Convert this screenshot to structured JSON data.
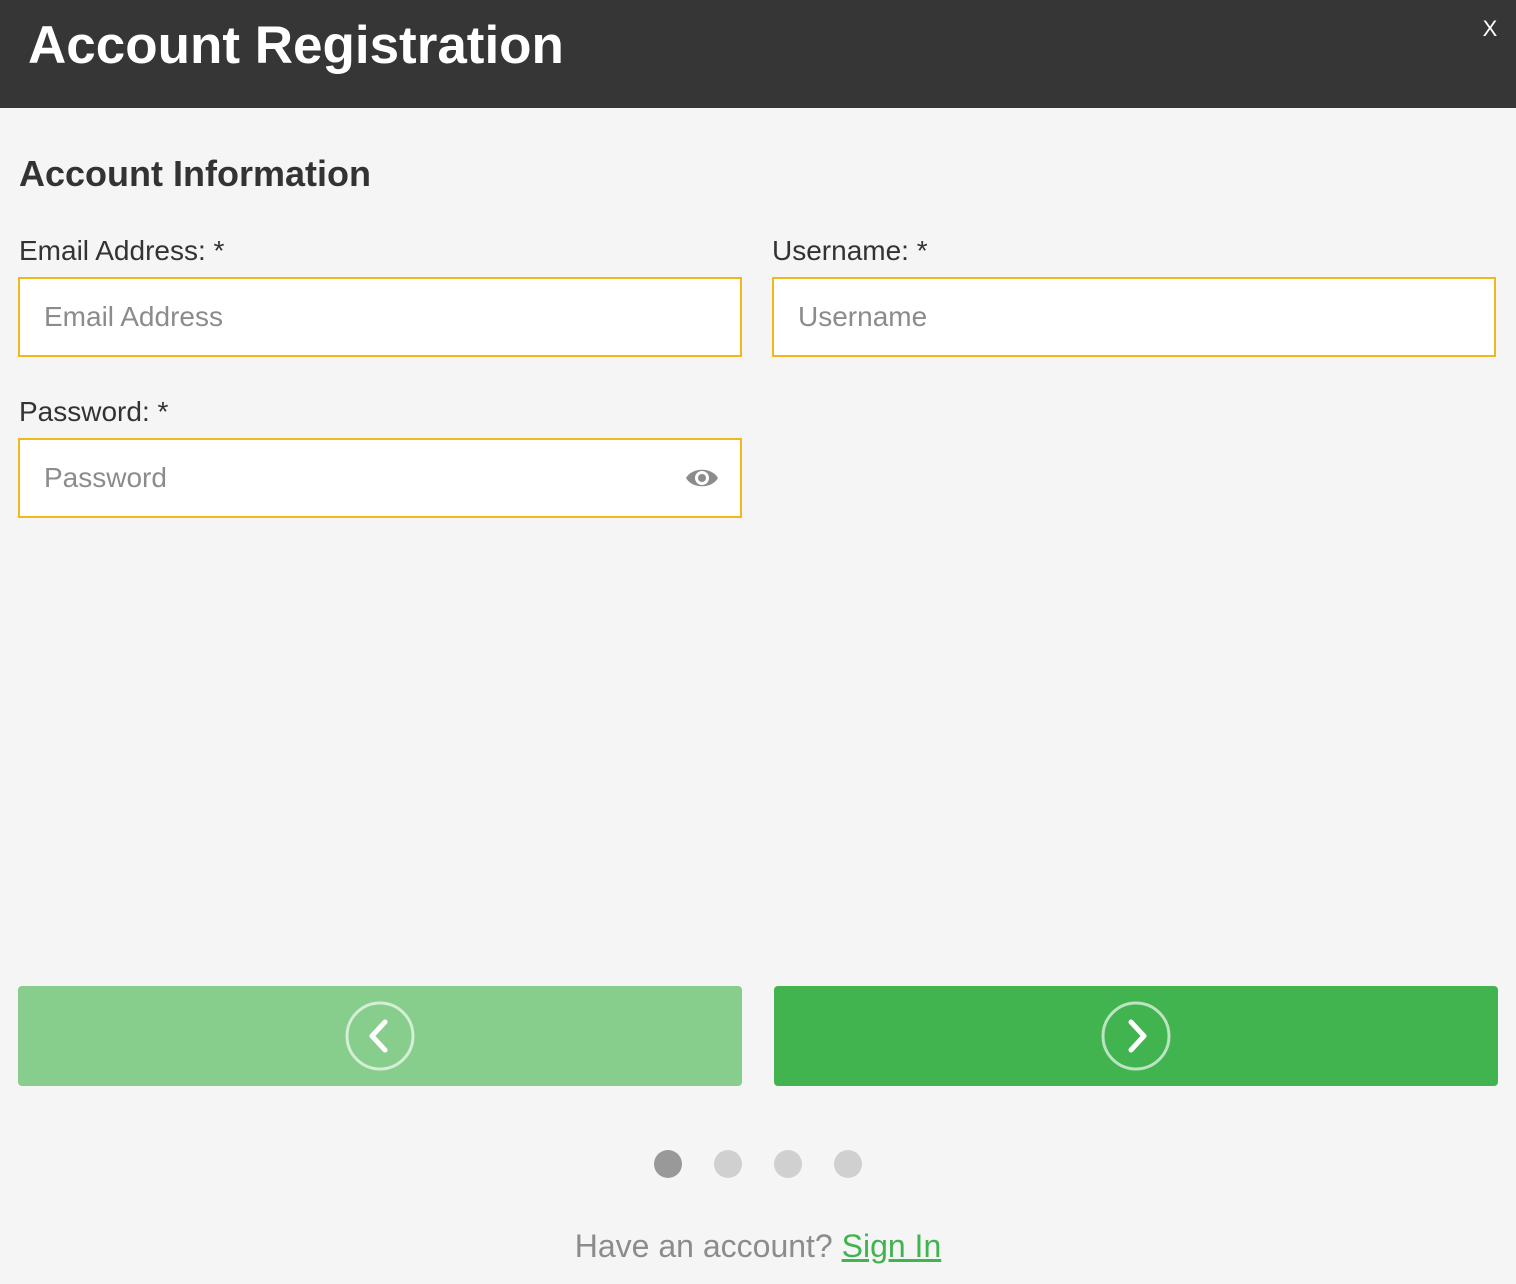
{
  "header": {
    "title": "Account Registration",
    "close_label": "X"
  },
  "section": {
    "title": "Account Information"
  },
  "fields": {
    "email": {
      "label": "Email Address: *",
      "value": "",
      "placeholder": "Email Address"
    },
    "username": {
      "label": "Username: *",
      "value": "",
      "placeholder": "Username"
    },
    "password": {
      "label": "Password: *",
      "value": "",
      "placeholder": "Password",
      "toggle_icon": "eye-icon"
    }
  },
  "navigation": {
    "prev_icon": "chevron-left-icon",
    "next_icon": "chevron-right-icon",
    "prev_enabled": false,
    "next_enabled": true
  },
  "steps": {
    "total": 4,
    "current": 1
  },
  "footer": {
    "text": "Have an account?",
    "link_label": "Sign In"
  },
  "colors": {
    "header_bg": "#363636",
    "page_bg": "#f5f5f5",
    "field_border": "#f0b81e",
    "primary_green": "#41b34f",
    "disabled_green": "#87cd8b",
    "dot_active": "#999999",
    "dot_inactive": "#d0d0d0",
    "link": "#41b34f"
  }
}
